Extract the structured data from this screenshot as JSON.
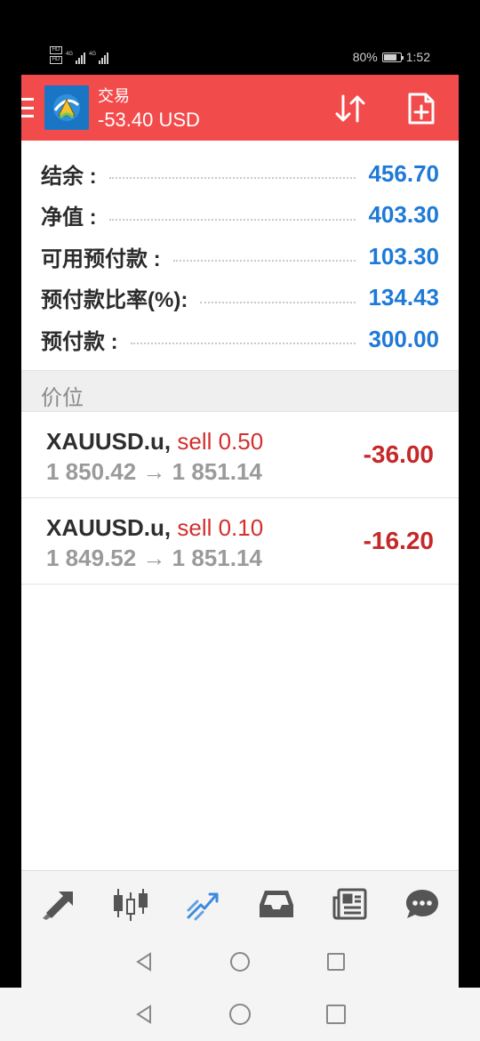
{
  "status_bar": {
    "battery": "80%",
    "time": "1:52",
    "network_1": "4G",
    "network_2": "4G",
    "hd_1": "HD",
    "hd_2": "HD"
  },
  "header": {
    "title": "交易",
    "balance_change": "-53.40 USD",
    "icons": [
      "menu-icon",
      "app-logo",
      "sort-icon",
      "new-order-icon"
    ]
  },
  "summary": [
    {
      "label": "结余 :",
      "value": "456.70"
    },
    {
      "label": "净值 :",
      "value": "403.30"
    },
    {
      "label": "可用预付款 :",
      "value": "103.30"
    },
    {
      "label": "预付款比率(%):",
      "value": "134.43"
    },
    {
      "label": "预付款 :",
      "value": "300.00"
    }
  ],
  "section": {
    "title": "价位"
  },
  "positions": [
    {
      "symbol": "XAUUSD.u,",
      "side": "sell 0.50",
      "prices": "1 850.42 → 1 851.14",
      "profit": "-36.00"
    },
    {
      "symbol": "XAUUSD.u,",
      "side": "sell 0.10",
      "prices": "1 849.52 → 1 851.14",
      "profit": "-16.20"
    }
  ],
  "bottom_nav": {
    "items": [
      "quotes-icon",
      "chart-icon",
      "trade-icon",
      "history-icon",
      "news-icon",
      "chat-icon"
    ],
    "active": "trade-icon",
    "active_color": "#3d8be0",
    "inactive_color": "#555555"
  },
  "colors": {
    "header": "#f24b4b",
    "value_blue": "#1e7ad6",
    "loss_red": "#c62828"
  }
}
